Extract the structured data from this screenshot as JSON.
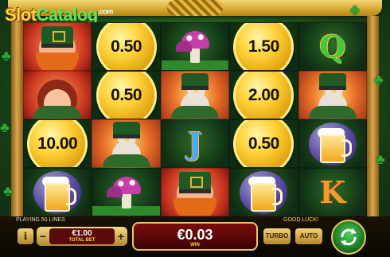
{
  "watermark": {
    "part1": "Slot",
    "part2": "Catalog",
    "suffix": ".com"
  },
  "reels": [
    [
      {
        "type": "leprechaun"
      },
      {
        "type": "lady"
      },
      {
        "type": "coin",
        "value": "10.00"
      },
      {
        "type": "beer"
      }
    ],
    [
      {
        "type": "coin",
        "value": "0.50"
      },
      {
        "type": "coin",
        "value": "0.50"
      },
      {
        "type": "hare"
      },
      {
        "type": "mushroom"
      }
    ],
    [
      {
        "type": "mushroom"
      },
      {
        "type": "hare"
      },
      {
        "type": "letter",
        "value": "J"
      },
      {
        "type": "leprechaun"
      }
    ],
    [
      {
        "type": "coin",
        "value": "1.50"
      },
      {
        "type": "coin",
        "value": "2.00"
      },
      {
        "type": "coin",
        "value": "0.50"
      },
      {
        "type": "beer"
      }
    ],
    [
      {
        "type": "letter",
        "value": "Q"
      },
      {
        "type": "hare"
      },
      {
        "type": "beer"
      },
      {
        "type": "letter",
        "value": "K"
      }
    ]
  ],
  "status": {
    "lines_text": "PLAYING 50 LINES",
    "good_luck": "GOOD LUCK!"
  },
  "controls": {
    "info_label": "i",
    "bet_value": "€1.00",
    "bet_label": "TOTAL BET",
    "minus_label": "−",
    "plus_label": "+",
    "win_value": "€0.03",
    "win_label": "WIN",
    "turbo_label": "TURBO",
    "auto_label": "AUTO"
  },
  "colors": {
    "accent_gold": "#f0c85a",
    "win_panel": "#7a0d0d",
    "spin_green": "#1f7a26"
  }
}
